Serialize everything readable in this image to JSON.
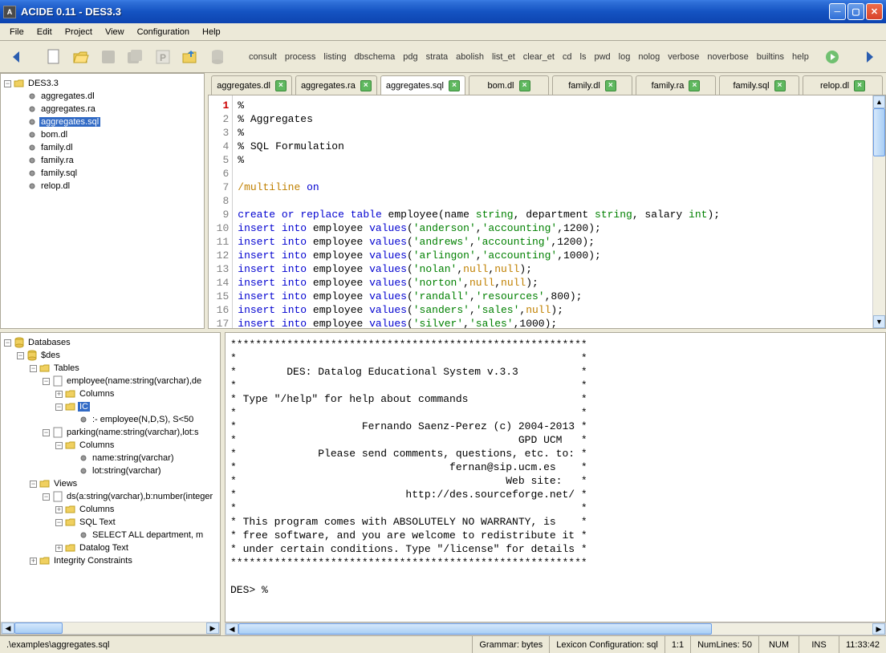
{
  "window": {
    "title": "ACIDE 0.11 - DES3.3"
  },
  "menu": [
    "File",
    "Edit",
    "Project",
    "View",
    "Configuration",
    "Help"
  ],
  "commands": [
    "consult",
    "process",
    "listing",
    "dbschema",
    "pdg",
    "strata",
    "abolish",
    "list_et",
    "clear_et",
    "cd",
    "ls",
    "pwd",
    "log",
    "nolog",
    "verbose",
    "noverbose",
    "builtins",
    "help"
  ],
  "project": {
    "name": "DES3.3",
    "files": [
      "aggregates.dl",
      "aggregates.ra",
      "aggregates.sql",
      "bom.dl",
      "family.dl",
      "family.ra",
      "family.sql",
      "relop.dl"
    ],
    "selected": "aggregates.sql"
  },
  "tabs": [
    {
      "label": "aggregates.dl"
    },
    {
      "label": "aggregates.ra"
    },
    {
      "label": "aggregates.sql",
      "active": true
    },
    {
      "label": "bom.dl"
    },
    {
      "label": "family.dl"
    },
    {
      "label": "family.ra"
    },
    {
      "label": "family.sql"
    },
    {
      "label": "relop.dl"
    }
  ],
  "editor": {
    "lines": [
      "%",
      "% Aggregates",
      "%",
      "% SQL Formulation",
      "%",
      "",
      "/multiline on",
      "",
      "create or replace table employee(name string, department string, salary int);",
      "insert into employee values('anderson','accounting',1200);",
      "insert into employee values('andrews','accounting',1200);",
      "insert into employee values('arlingon','accounting',1000);",
      "insert into employee values('nolan',null,null);",
      "insert into employee values('norton',null,null);",
      "insert into employee values('randall','resources',800);",
      "insert into employee values('sanders','sales',null);",
      "insert into employee values('silver','sales',1000);"
    ]
  },
  "db_tree": {
    "root": "Databases",
    "db": "$des",
    "tables_label": "Tables",
    "employee_sig": "employee(name:string(varchar),de",
    "columns_label": "Columns",
    "ic_label": "IC",
    "ic_item": ":- employee(N,D,S), S<50",
    "parking_sig": "parking(name:string(varchar),lot:s",
    "parking_cols": [
      "name:string(varchar)",
      "lot:string(varchar)"
    ],
    "views_label": "Views",
    "view_sig": "ds(a:string(varchar),b:number(integer",
    "sql_text_label": "SQL Text",
    "sql_text": "SELECT ALL department, m",
    "datalog_text_label": "Datalog Text",
    "integrity_label": "Integrity Constraints"
  },
  "console": {
    "banner": [
      "*********************************************************",
      "*                                                       *",
      "*        DES: Datalog Educational System v.3.3          *",
      "*                                                       *",
      "* Type \"/help\" for help about commands                  *",
      "*                                                       *",
      "*                    Fernando Saenz-Perez (c) 2004-2013 *",
      "*                                             GPD UCM   *",
      "*             Please send comments, questions, etc. to: *",
      "*                                  fernan@sip.ucm.es    *",
      "*                                           Web site:   *",
      "*                           http://des.sourceforge.net/ *",
      "*                                                       *",
      "* This program comes with ABSOLUTELY NO WARRANTY, is    *",
      "* free software, and you are welcome to redistribute it *",
      "* under certain conditions. Type \"/license\" for details *",
      "*********************************************************",
      "",
      "DES> %"
    ]
  },
  "status": {
    "path": ".\\examples\\aggregates.sql",
    "grammar": "Grammar: bytes",
    "lexicon": "Lexicon Configuration: sql",
    "pos": "1:1",
    "numlines": "NumLines: 50",
    "num": "NUM",
    "ins": "INS",
    "time": "11:33:42"
  }
}
